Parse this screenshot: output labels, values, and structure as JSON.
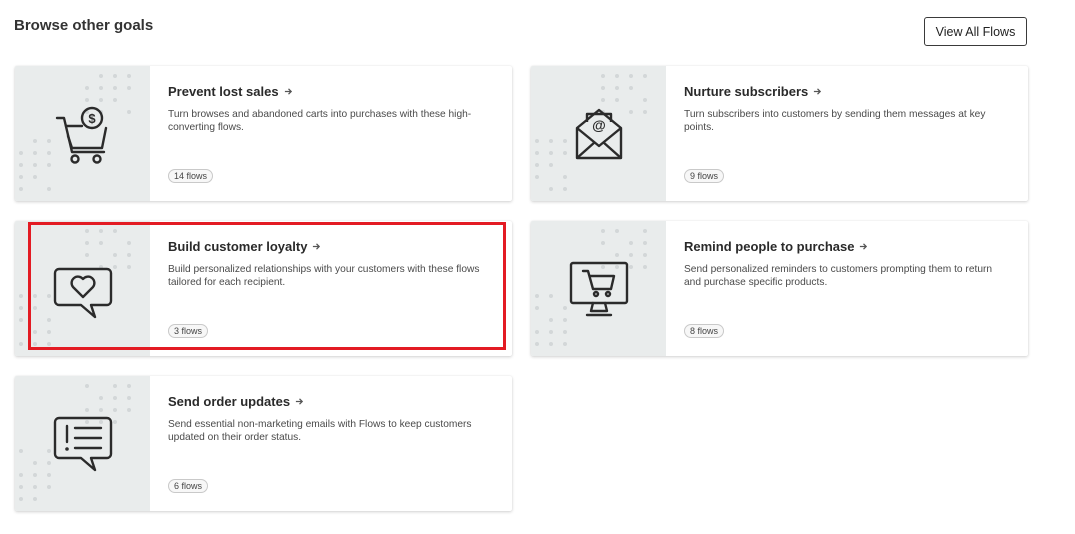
{
  "header": {
    "title": "Browse other goals",
    "view_all_label": "View All Flows"
  },
  "cards": [
    {
      "title": "Prevent lost sales",
      "description": "Turn browses and abandoned carts into purchases with these high-converting flows.",
      "badge": "14 flows",
      "icon": "shopping-cart-dollar-icon"
    },
    {
      "title": "Nurture subscribers",
      "description": "Turn subscribers into customers by sending them messages at key points.",
      "badge": "9 flows",
      "icon": "email-envelope-icon"
    },
    {
      "title": "Build customer loyalty",
      "description": "Build personalized relationships with your customers with these flows tailored for each recipient.",
      "badge": "3 flows",
      "icon": "heart-chat-bubble-icon"
    },
    {
      "title": "Remind people to purchase",
      "description": "Send personalized reminders to customers prompting them to return and purchase specific products.",
      "badge": "8 flows",
      "icon": "monitor-cart-icon"
    },
    {
      "title": "Send order updates",
      "description": "Send essential non-marketing emails with Flows to keep customers updated on their order status.",
      "badge": "6 flows",
      "icon": "alert-chat-bubble-icon"
    }
  ],
  "colors": {
    "highlight": "#e31b23",
    "image_bg": "#e9ecec",
    "dot": "#d3d7d8"
  }
}
